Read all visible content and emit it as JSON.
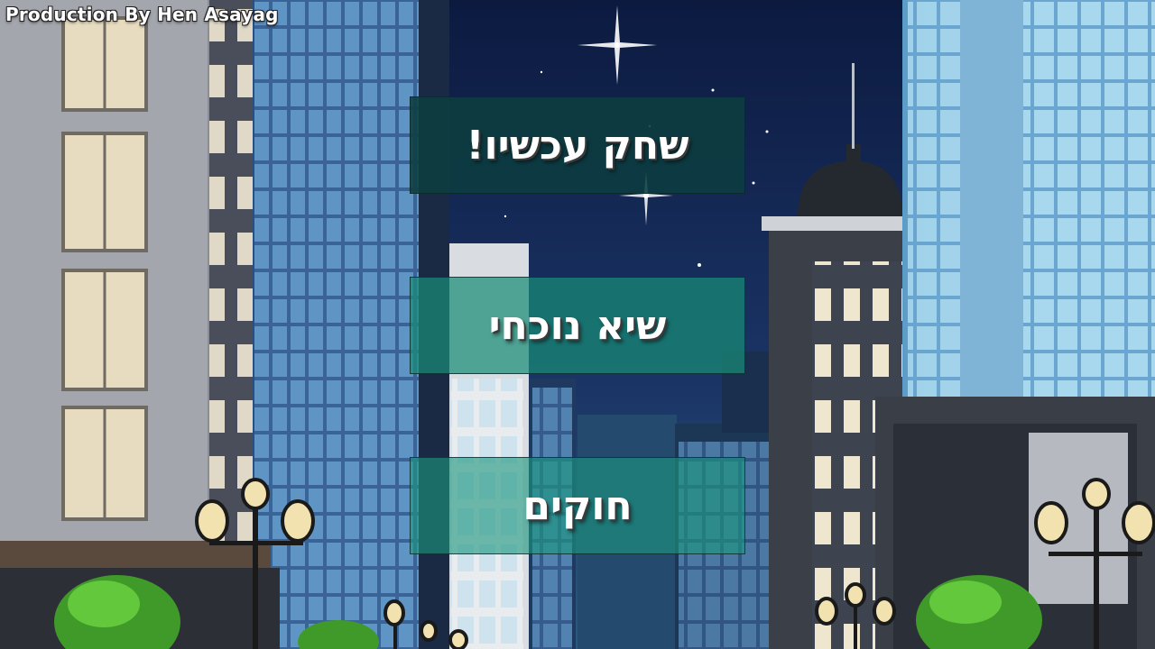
{
  "credit": "Production By Hen Asayag",
  "menu": {
    "play_label": "שחק עכשיו!",
    "leaderboard_label": "שיא נוכחי",
    "rules_label": "חוקים"
  },
  "colors": {
    "sky": "#0f1e45",
    "play_button": "#0c3e40",
    "secondary_button": "#1c967e"
  }
}
